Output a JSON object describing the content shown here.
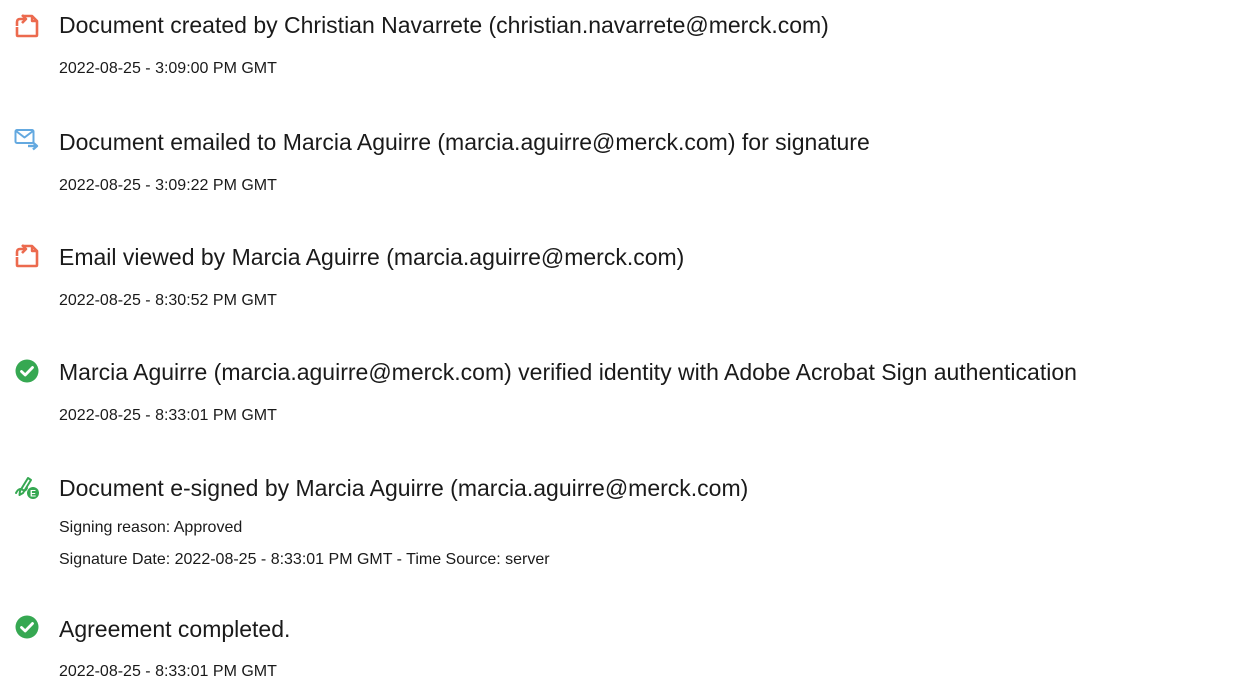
{
  "events": [
    {
      "icon": "document-icon",
      "title": "Document created by Christian Navarrete (christian.navarrete@merck.com)",
      "details": [
        "2022-08-25 - 3:09:00 PM GMT"
      ]
    },
    {
      "icon": "email-sent-icon",
      "title": "Document emailed to Marcia Aguirre (marcia.aguirre@merck.com) for signature",
      "details": [
        "2022-08-25 - 3:09:22 PM GMT"
      ]
    },
    {
      "icon": "document-icon",
      "title": "Email viewed by Marcia Aguirre (marcia.aguirre@merck.com)",
      "details": [
        "2022-08-25 - 8:30:52 PM GMT"
      ]
    },
    {
      "icon": "check-circle-icon",
      "title": "Marcia Aguirre (marcia.aguirre@merck.com) verified identity with Adobe Acrobat Sign authentication",
      "details": [
        "2022-08-25 - 8:33:01 PM GMT"
      ]
    },
    {
      "icon": "e-sign-pen-icon",
      "title": "Document e-signed by Marcia Aguirre (marcia.aguirre@merck.com)",
      "details": [
        "Signing reason: Approved",
        "Signature Date: 2022-08-25 - 8:33:01 PM GMT - Time Source: server"
      ]
    },
    {
      "icon": "check-circle-icon",
      "title": "Agreement completed.",
      "details": [
        "2022-08-25 - 8:33:01 PM GMT"
      ]
    }
  ],
  "colors": {
    "orange_icon": "#EC6A4E",
    "blue_icon": "#64A9E0",
    "green_icon": "#36A852",
    "text": "#1A1A1A"
  }
}
